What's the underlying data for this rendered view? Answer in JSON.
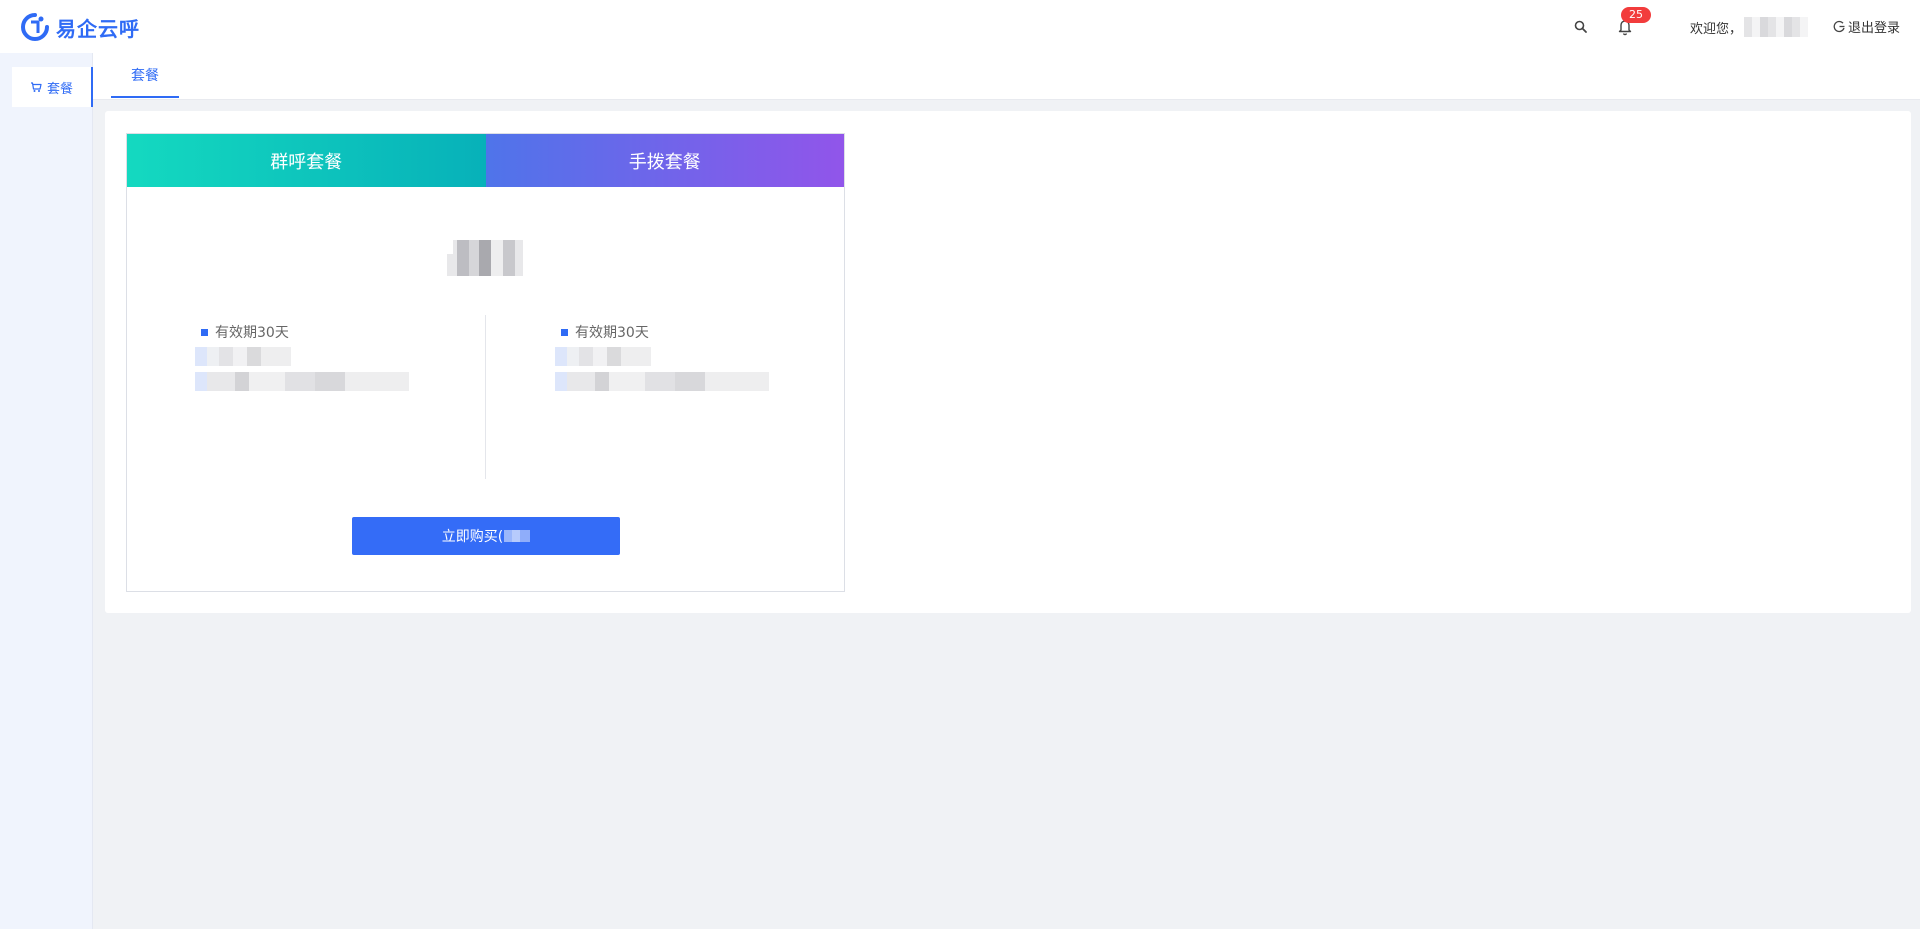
{
  "app": {
    "name": "易企云呼",
    "brand_color": "#2f6bf5"
  },
  "header": {
    "notification_count": "25",
    "welcome_text": "欢迎您，",
    "logout_label": "退出登录"
  },
  "sidebar": {
    "items": [
      {
        "label": "套餐",
        "icon": "cart-icon",
        "active": true
      }
    ]
  },
  "tabs": [
    {
      "label": "套餐",
      "active": true
    }
  ],
  "package_panel": {
    "tabs": [
      {
        "label": "群呼套餐",
        "active": true,
        "gradient": [
          "#14d9c0",
          "#07b1b9"
        ]
      },
      {
        "label": "手拨套餐",
        "active": false,
        "gradient": [
          "#4f74ea",
          "#9155ea"
        ]
      }
    ],
    "columns": [
      {
        "validity": "有效期30天"
      },
      {
        "validity": "有效期30天"
      }
    ],
    "buy_button_label": "立即购买("
  }
}
